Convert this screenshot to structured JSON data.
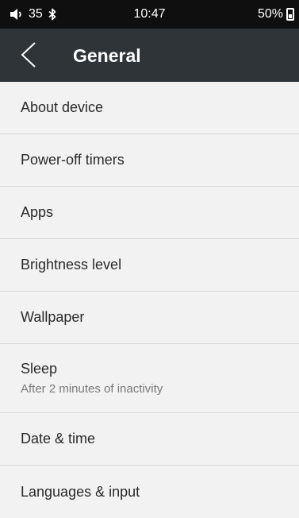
{
  "status_bar": {
    "volume_icon": "speaker-icon",
    "volume": "35",
    "bluetooth_icon": "bluetooth-icon",
    "time": "10:47",
    "battery": "50%",
    "battery_icon": "battery-icon"
  },
  "header": {
    "back_icon": "chevron-left-icon",
    "title": "General"
  },
  "settings": {
    "items": [
      {
        "label": "About device"
      },
      {
        "label": "Power-off timers"
      },
      {
        "label": "Apps"
      },
      {
        "label": "Brightness level"
      },
      {
        "label": "Wallpaper"
      },
      {
        "label": "Sleep",
        "sublabel": "After 2 minutes of inactivity"
      },
      {
        "label": "Date & time"
      },
      {
        "label": "Languages & input"
      }
    ]
  },
  "colors": {
    "status_bar_bg": "#0f0f0f",
    "title_bar_bg": "#2e3438",
    "list_bg": "#f2f2f2",
    "divider": "#d7d7d7"
  }
}
